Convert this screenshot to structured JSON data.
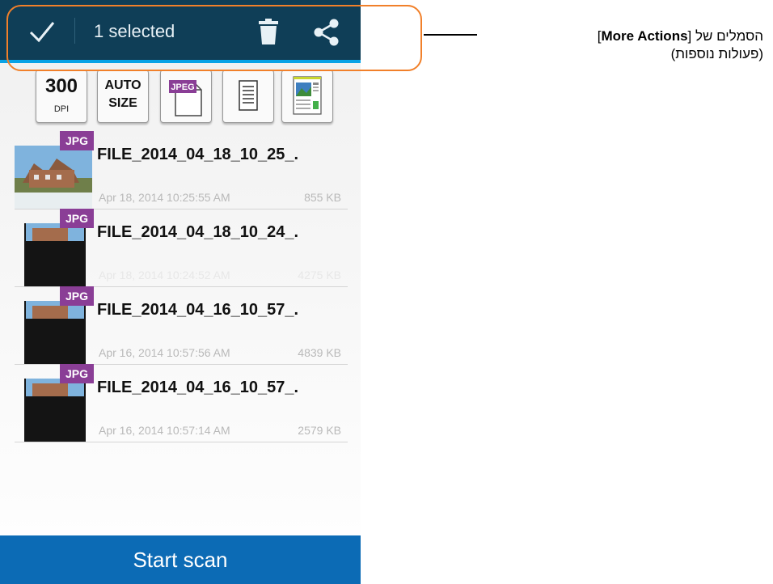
{
  "appbar": {
    "selection_label": "1 selected",
    "icons": [
      "check-icon",
      "trash-icon",
      "share-icon"
    ],
    "colors": {
      "bar": "#0f3e57",
      "accent": "#0aa3e6"
    }
  },
  "toolbar": {
    "dpi_value": "300",
    "dpi_unit": "DPI",
    "auto_line1": "AUTO",
    "auto_line2": "SIZE",
    "jpeg_label": "JPEG",
    "icons": [
      "dpi-button",
      "auto-size-button",
      "jpeg-format-icon",
      "document-icon",
      "image-document-icon"
    ]
  },
  "files": [
    {
      "badge": "JPG",
      "name": "FILE_2014_04_18_10_25_.",
      "date": "Apr 18, 2014 10:25:55 AM",
      "size": "855 KB"
    },
    {
      "badge": "JPG",
      "name": "FILE_2014_04_18_10_24_.",
      "date": "Apr 18, 2014 10:24:52 AM",
      "size": "4275 KB"
    },
    {
      "badge": "JPG",
      "name": "FILE_2014_04_16_10_57_.",
      "date": "Apr 16, 2014 10:57:56 AM",
      "size": "4839 KB"
    },
    {
      "badge": "JPG",
      "name": "FILE_2014_04_16_10_57_.",
      "date": "Apr 16, 2014 10:57:14 AM",
      "size": "2579 KB"
    }
  ],
  "start_scan_label": "Start scan",
  "annotation": {
    "prefix": "הסמלים של [",
    "bold": "More Actions",
    "suffix": "]",
    "line2": "(פעולות נוספות)",
    "highlight_color": "#f1802a"
  }
}
